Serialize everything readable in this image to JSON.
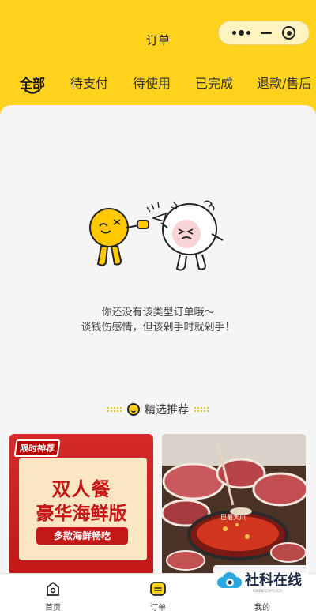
{
  "app": {
    "title": "订单"
  },
  "tabs": [
    {
      "label": "全部",
      "active": true
    },
    {
      "label": "待支付"
    },
    {
      "label": "待使用"
    },
    {
      "label": "已完成"
    },
    {
      "label": "退款/售后"
    }
  ],
  "empty": {
    "line1": "你还没有该类型订单哦～",
    "line2": "谈钱伤感情，但该剁手时就剁手！"
  },
  "recommend": {
    "title": "精选推荐",
    "cards": [
      {
        "tag": "限时神荐",
        "line1": "双人餐",
        "line2": "豪华海鲜版",
        "pill": "多款海鲜畅吃"
      },
      {
        "image": "hotpot-photo",
        "sign": "巴蜀大川"
      }
    ]
  },
  "tabbar": [
    {
      "label": "首页",
      "icon": "home-icon"
    },
    {
      "label": "订单",
      "icon": "order-icon",
      "active": true
    },
    {
      "label": "我的",
      "icon": "profile-icon"
    }
  ],
  "watermark": {
    "text": "社科在线",
    "sub": "cass.com.cn"
  },
  "colors": {
    "brand": "#FFD21E",
    "red": "#C61616"
  }
}
